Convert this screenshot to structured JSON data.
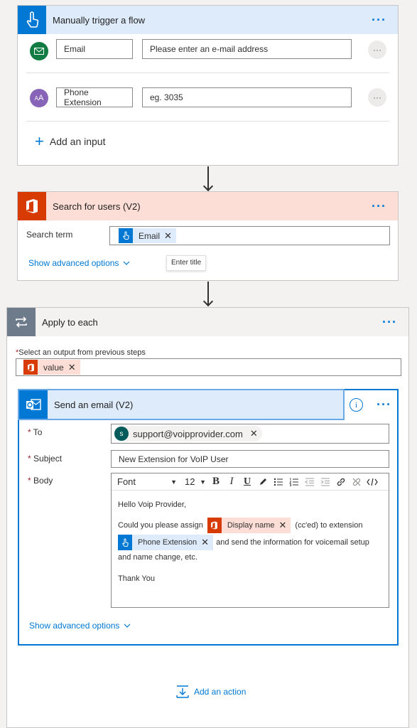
{
  "trigger": {
    "title": "Manually trigger a flow",
    "more": "···",
    "inputs": [
      {
        "name": "Email",
        "placeholder": "Please enter an e-mail address",
        "more": "···"
      },
      {
        "name": "Phone Extension",
        "placeholder": "eg. 3035",
        "more": "···"
      }
    ],
    "add_input": "Add an input"
  },
  "search": {
    "title": "Search for users (V2)",
    "more": "···",
    "term_label": "Search term",
    "token": "Email",
    "advanced": "Show advanced options",
    "tooltip": "Enter title"
  },
  "apply": {
    "title": "Apply to each",
    "more": "···",
    "select_label": "Select an output from previous steps",
    "token": "value"
  },
  "email": {
    "title": "Send an email (V2)",
    "more": "···",
    "info": "i",
    "to_label": "To",
    "to_avatar": "s",
    "to_value": "support@voipprovider.com",
    "subject_label": "Subject",
    "subject_value": "New Extension for VoIP User",
    "body_label": "Body",
    "font": "Font",
    "size": "12",
    "body_line1": "Hello Voip Provider,",
    "body_line2a": "Could you please assign",
    "token_display": "Display name",
    "body_line2b": "(cc'ed) to extension",
    "token_phone": "Phone Extension",
    "body_line3a": "and send the information for voicemail setup",
    "body_line3b": "and name change, etc.",
    "body_line4": "Thank You",
    "advanced": "Show advanced options"
  },
  "add_action": "Add an action",
  "colors": {
    "accent": "#0078d4",
    "office": "#d83b01",
    "trigger_header": "#ddebfb",
    "search_header": "#fcded6",
    "apply_header": "#f3f2f1"
  }
}
